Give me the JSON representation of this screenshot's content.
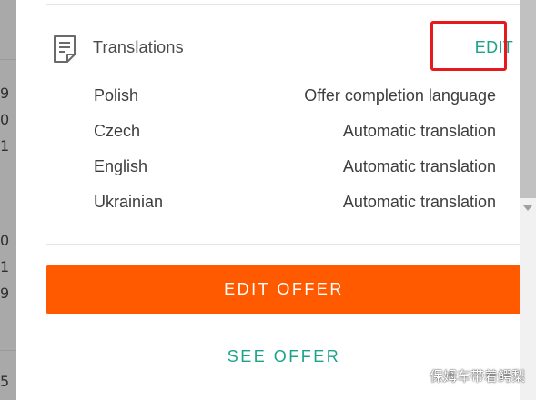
{
  "background": {
    "partial_numbers": [
      "9",
      "0",
      "1",
      "0",
      "1",
      "9",
      "5"
    ]
  },
  "translations": {
    "icon": "document-icon",
    "title": "Translations",
    "edit_label": "EDIT",
    "rows": [
      {
        "language": "Polish",
        "status": "Offer completion language"
      },
      {
        "language": "Czech",
        "status": "Automatic translation"
      },
      {
        "language": "English",
        "status": "Automatic translation"
      },
      {
        "language": "Ukrainian",
        "status": "Automatic translation"
      }
    ]
  },
  "actions": {
    "edit_offer_label": "EDIT OFFER",
    "see_offer_label": "SEE OFFER"
  },
  "watermark": {
    "text": "保姆车带着鳄梨"
  },
  "colors": {
    "accent_green": "#1aa389",
    "primary_orange": "#ff5a00",
    "highlight_red": "#e8191c",
    "text_dark": "#3d3d3d"
  }
}
